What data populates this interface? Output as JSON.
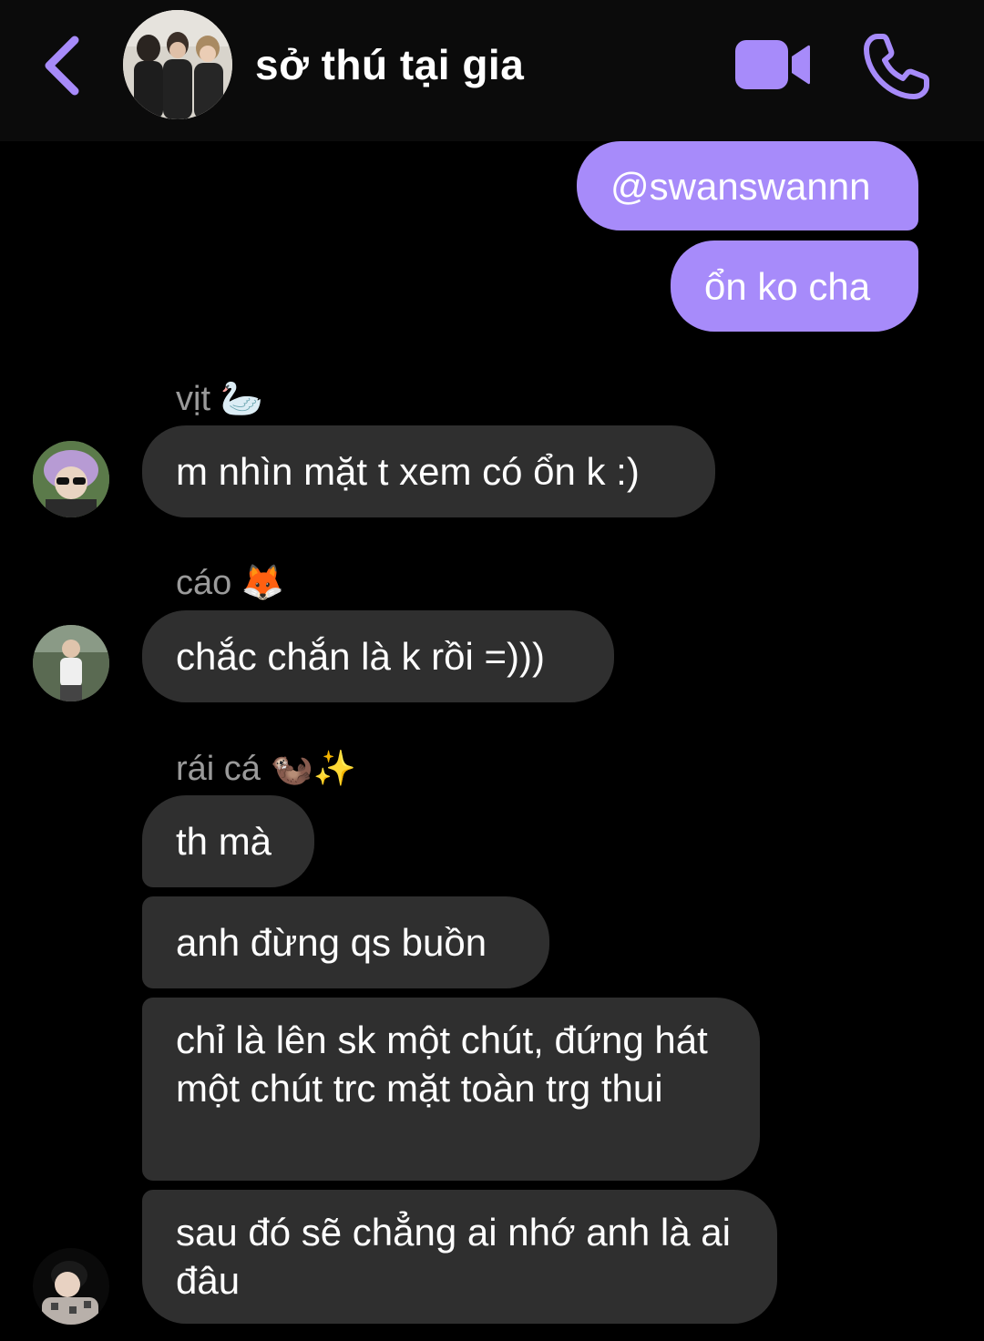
{
  "header": {
    "group_name": "sở thú tại gia"
  },
  "colors": {
    "accent": "#a78bfa",
    "incoming_bubble": "#2f2f2f",
    "header_bg": "#0b0b0b",
    "sender_name": "#9a9a9a"
  },
  "messages": {
    "outgoing": [
      "@swanswannn",
      "ổn ko cha"
    ],
    "sender1": {
      "name": "vịt",
      "emoji": "🦢"
    },
    "msg1": "m nhìn mặt t xem có ổn k :)",
    "sender2": {
      "name": "cáo",
      "emoji": "🦊"
    },
    "msg2": "chắc chắn là k rồi =)))",
    "sender3": {
      "name": "rái cá",
      "emoji": "🦦✨"
    },
    "msg3": [
      "th mà",
      "anh đừng qs buồn",
      "chỉ là lên sk một chút, đứng hát một chút trc mặt toàn trg thui",
      "sau đó sẽ chẳng ai nhớ anh là ai đâu"
    ]
  },
  "icons": {
    "back": "chevron-left-icon",
    "video": "video-camera-icon",
    "call": "phone-icon"
  }
}
